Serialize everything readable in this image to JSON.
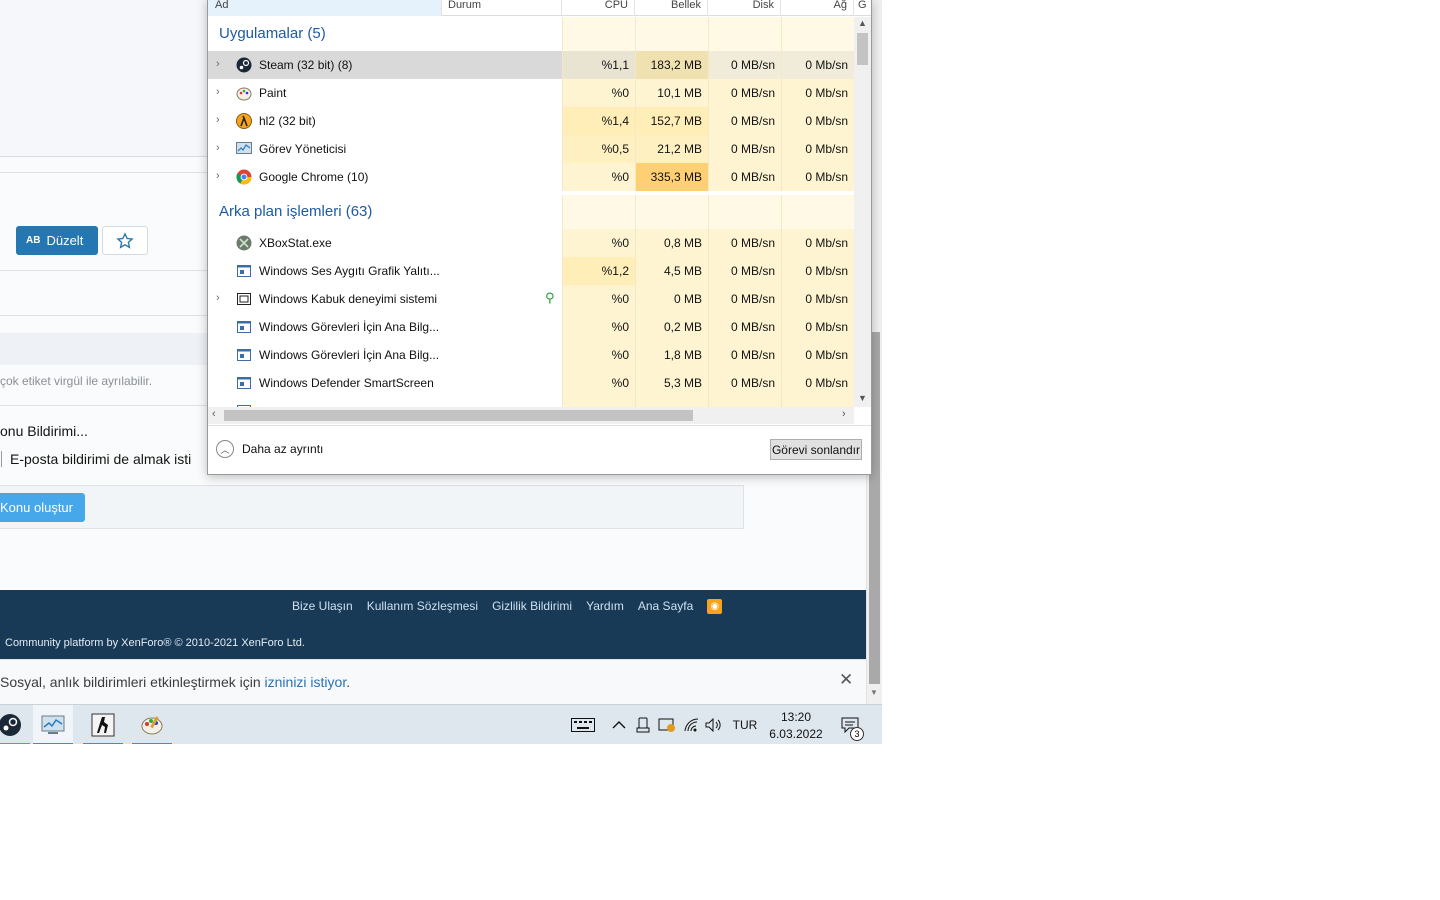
{
  "forum": {
    "edit_label": "Düzelt",
    "edit_ab": "AB",
    "tag_hint": "çok etiket virgül ile ayrılabilir.",
    "notify_title": "onu Bildirimi...",
    "email_label": "E-posta bildirimi de almak isti",
    "submit_label": "Konu oluştur",
    "footer_links": [
      "Bize Ulaşın",
      "Kullanım Sözleşmesi",
      "Gizlilik Bildirimi",
      "Yardım",
      "Ana Sayfa"
    ],
    "copyright": "Community platform by XenForo® © 2010-2021 XenForo Ltd.",
    "notif_text": "Sosyal, anlık bildirimleri etkinleştirmek için ",
    "notif_link": "izninizi istiyor",
    "notif_end": ".",
    "notif_close": "✕"
  },
  "task_manager": {
    "columns": {
      "name": "Ad",
      "status": "Durum",
      "cpu": "CPU",
      "memory": "Bellek",
      "disk": "Disk",
      "network": "Ağ",
      "gpu": "G"
    },
    "apps_group": "Uygulamalar (5)",
    "apps": [
      {
        "name": "Steam (32 bit) (8)",
        "cpu": "%1,1",
        "mem": "183,2 MB",
        "disk": "0 MB/sn",
        "net": "0 Mb/sn",
        "icon": "steam-icon",
        "expandable": true,
        "selected": true
      },
      {
        "name": "Paint",
        "cpu": "%0",
        "mem": "10,1 MB",
        "disk": "0 MB/sn",
        "net": "0 Mb/sn",
        "icon": "paint-icon",
        "expandable": true
      },
      {
        "name": "hl2 (32 bit)",
        "cpu": "%1,4",
        "mem": "152,7 MB",
        "disk": "0 MB/sn",
        "net": "0 Mb/sn",
        "icon": "half-life-icon",
        "expandable": true
      },
      {
        "name": "Görev Yöneticisi",
        "cpu": "%0,5",
        "mem": "21,2 MB",
        "disk": "0 MB/sn",
        "net": "0 Mb/sn",
        "icon": "task-manager-icon",
        "expandable": true
      },
      {
        "name": "Google Chrome (10)",
        "cpu": "%0",
        "mem": "335,3 MB",
        "disk": "0 MB/sn",
        "net": "0 Mb/sn",
        "icon": "chrome-icon",
        "expandable": true
      }
    ],
    "bg_group": "Arka plan işlemleri (63)",
    "background": [
      {
        "name": "XBoxStat.exe",
        "cpu": "%0",
        "mem": "0,8 MB",
        "disk": "0 MB/sn",
        "net": "0 Mb/sn",
        "icon": "xbox-icon",
        "expandable": false
      },
      {
        "name": "Windows Ses Aygıtı Grafik Yalıtı...",
        "cpu": "%1,2",
        "mem": "4,5 MB",
        "disk": "0 MB/sn",
        "net": "0 Mb/sn",
        "icon": "process-icon",
        "expandable": false
      },
      {
        "name": "Windows Kabuk deneyimi sistemi",
        "cpu": "%0",
        "mem": "0 MB",
        "disk": "0 MB/sn",
        "net": "0 Mb/sn",
        "icon": "shell-icon",
        "expandable": true,
        "suspended": true
      },
      {
        "name": "Windows Görevleri İçin Ana Bilg...",
        "cpu": "%0",
        "mem": "0,2 MB",
        "disk": "0 MB/sn",
        "net": "0 Mb/sn",
        "icon": "process-icon",
        "expandable": false
      },
      {
        "name": "Windows Görevleri İçin Ana Bilg...",
        "cpu": "%0",
        "mem": "1,8 MB",
        "disk": "0 MB/sn",
        "net": "0 Mb/sn",
        "icon": "process-icon",
        "expandable": false
      },
      {
        "name": "Windows Defender SmartScreen",
        "cpu": "%0",
        "mem": "5,3 MB",
        "disk": "0 MB/sn",
        "net": "0 Mb/sn",
        "icon": "process-icon",
        "expandable": false
      }
    ],
    "fewer_details": "Daha az ayrıntı",
    "end_task": "Görevi sonlandır"
  },
  "taskbar": {
    "language": "TUR",
    "time": "13:20",
    "date": "6.03.2022",
    "notification_count": "3"
  },
  "colors": {
    "heat_light": "#fff9e5",
    "heat_mid": "#fff0c1",
    "heat_strong": "#ffe39a",
    "heat_high": "#ffd073",
    "group_title": "#1e5aa8",
    "footer_bg": "#183a57",
    "accent_blue": "#2577b1"
  }
}
